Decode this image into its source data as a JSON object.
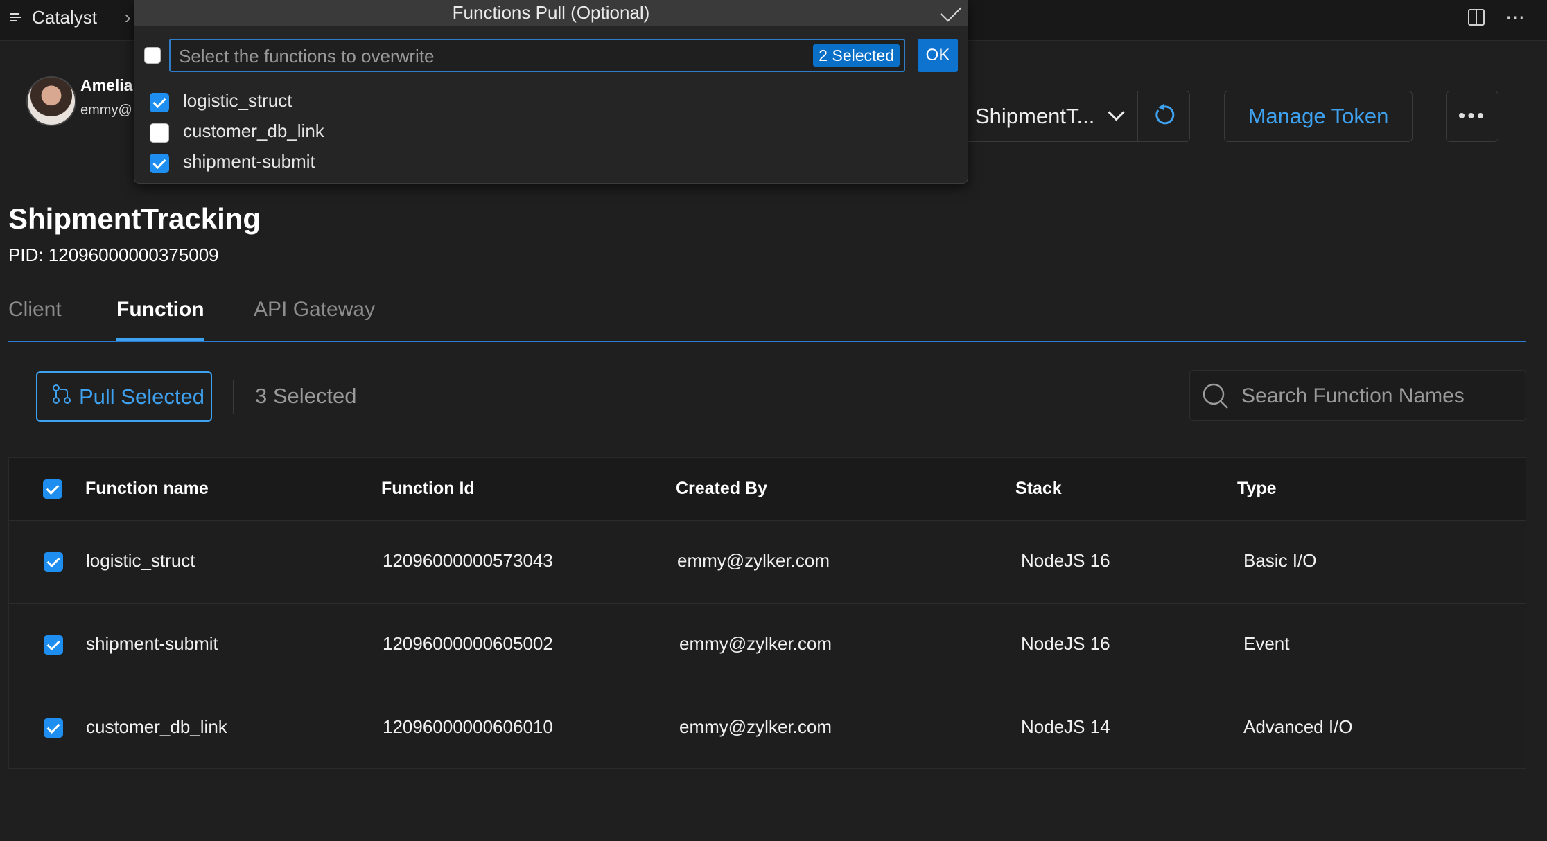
{
  "topbar": {
    "app_name": "Catalyst"
  },
  "user": {
    "name": "Amelia",
    "email": "emmy@"
  },
  "toolbar": {
    "project_select": "ShipmentT...",
    "manage_token": "Manage Token",
    "more": "•••"
  },
  "project": {
    "name": "ShipmentTracking",
    "pid": "PID: 12096000000375009"
  },
  "tabs": [
    {
      "label": "Client",
      "active": false
    },
    {
      "label": "Function",
      "active": true
    },
    {
      "label": "API Gateway",
      "active": false
    }
  ],
  "actions": {
    "pull_selected": "Pull Selected",
    "selected_count": "3 Selected",
    "search_placeholder": "Search Function Names"
  },
  "table": {
    "headers": [
      "Function name",
      "Function Id",
      "Created By",
      "Stack",
      "Type"
    ],
    "rows": [
      {
        "name": "logistic_struct",
        "id": "12096000000573043",
        "created_by": "emmy@zylker.com",
        "stack": "NodeJS 16",
        "type": "Basic I/O",
        "checked": true
      },
      {
        "name": "shipment-submit",
        "id": "12096000000605002",
        "created_by": "emmy@zylker.com",
        "stack": "NodeJS 16",
        "type": "Event",
        "checked": true
      },
      {
        "name": "customer_db_link",
        "id": "12096000000606010",
        "created_by": "emmy@zylker.com",
        "stack": "NodeJS 14",
        "type": "Advanced I/O",
        "checked": true
      }
    ]
  },
  "modal": {
    "title": "Functions Pull (Optional)",
    "input_placeholder": "Select the functions to overwrite",
    "badge": "2 Selected",
    "ok": "OK",
    "options": [
      {
        "label": "logistic_struct",
        "checked": true
      },
      {
        "label": "customer_db_link",
        "checked": false
      },
      {
        "label": "shipment-submit",
        "checked": true
      }
    ]
  },
  "colors": {
    "accent": "#3fa2f0",
    "background": "#1f1f1f",
    "checkbox": "#1f8ef1"
  }
}
